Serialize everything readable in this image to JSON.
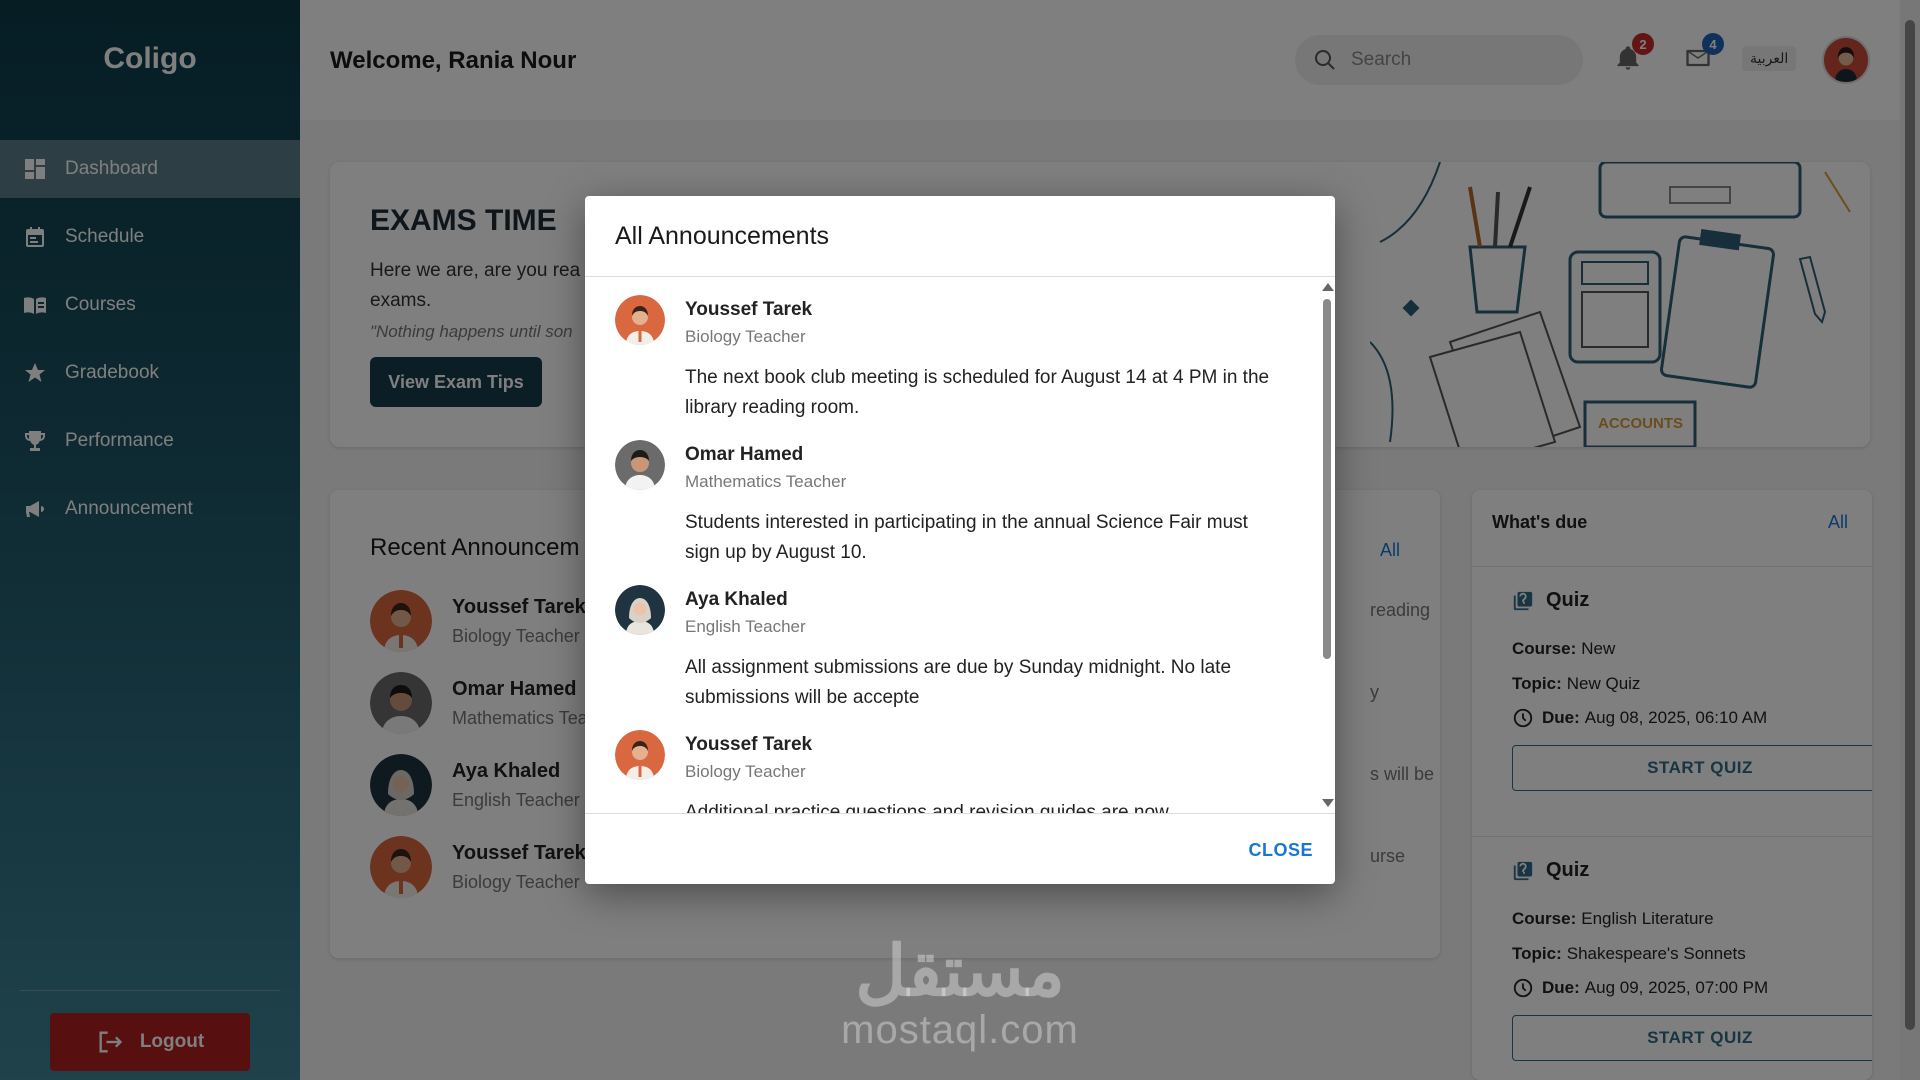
{
  "app": {
    "name": "Coligo"
  },
  "sidebar": {
    "items": [
      {
        "label": "Dashboard",
        "icon": "dashboard-icon",
        "active": true
      },
      {
        "label": "Schedule",
        "icon": "calendar-icon",
        "active": false
      },
      {
        "label": "Courses",
        "icon": "book-icon",
        "active": false
      },
      {
        "label": "Gradebook",
        "icon": "star-icon",
        "active": false
      },
      {
        "label": "Performance",
        "icon": "trophy-icon",
        "active": false
      },
      {
        "label": "Announcement",
        "icon": "megaphone-icon",
        "active": false
      }
    ],
    "logout_label": "Logout"
  },
  "header": {
    "welcome": "Welcome, Rania Nour",
    "search_placeholder": "Search",
    "notifications_count": "2",
    "messages_count": "4",
    "language": "العربية"
  },
  "hero": {
    "title": "EXAMS TIME",
    "text": "Here we are, are you rea",
    "text2": "exams.",
    "quote": "\"Nothing happens until son",
    "button": "View Exam Tips",
    "art_label": "ACCOUNTS"
  },
  "recent": {
    "title": "Recent Announcem",
    "all_label": "All",
    "items": [
      {
        "name": "Youssef Tarek",
        "role": "Biology Teacher",
        "snippet": "reading"
      },
      {
        "name": "Omar Hamed",
        "role": "Mathematics Tea",
        "snippet": "y"
      },
      {
        "name": "Aya Khaled",
        "role": "English Teacher",
        "snippet": "s will be"
      },
      {
        "name": "Youssef Tarek",
        "role": "Biology Teacher",
        "snippet": "urse"
      }
    ]
  },
  "due": {
    "title": "What's due",
    "all_label": "All",
    "quizzes": [
      {
        "title": "Quiz",
        "course_label": "Course:",
        "course": "New",
        "topic_label": "Topic:",
        "topic": "New Quiz",
        "due_label": "Due:",
        "due": "Aug 08, 2025, 06:10 AM",
        "button": "START QUIZ"
      },
      {
        "title": "Quiz",
        "course_label": "Course:",
        "course": "English Literature",
        "topic_label": "Topic:",
        "topic": "Shakespeare's Sonnets",
        "due_label": "Due:",
        "due": "Aug 09, 2025, 07:00 PM",
        "button": "START QUIZ"
      }
    ]
  },
  "modal": {
    "title": "All Announcements",
    "close_label": "CLOSE",
    "items": [
      {
        "name": "Youssef Tarek",
        "role": "Biology Teacher",
        "text": "The next book club meeting is scheduled for August 14 at 4 PM in the library reading room."
      },
      {
        "name": "Omar Hamed",
        "role": "Mathematics Teacher",
        "text": "Students interested in participating in the annual Science Fair must sign up by August 10."
      },
      {
        "name": "Aya Khaled",
        "role": "English Teacher",
        "text": "All assignment submissions are due by Sunday midnight. No late submissions will be accepte"
      },
      {
        "name": "Youssef Tarek",
        "role": "Biology Teacher",
        "text": "Additional practice questions and revision guides are now"
      }
    ]
  },
  "watermark": {
    "arabic": "مستقل",
    "latin": "mostaql.com"
  },
  "colors": {
    "sidebar_dark": "#0c3a48",
    "accent": "#1976d2",
    "logout": "#b11f1f",
    "badge_red": "#c62828",
    "badge_blue": "#1e63b8"
  }
}
